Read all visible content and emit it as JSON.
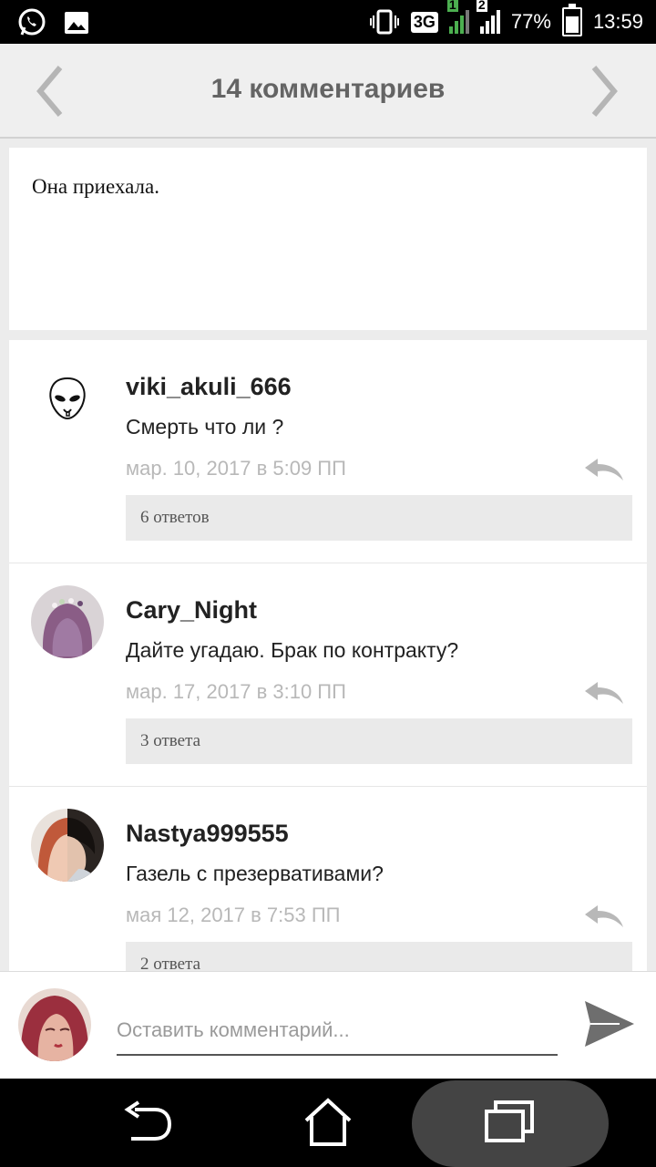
{
  "status_bar": {
    "network_type": "3G",
    "sim1_label": "1",
    "sim2_label": "2",
    "battery_percent": "77%",
    "battery_level": 0.77,
    "time": "13:59"
  },
  "header": {
    "title": "14 комментариев"
  },
  "post": {
    "text": "Она приехала."
  },
  "comments": [
    {
      "username": "viki_akuli_666",
      "text": "Смерть что ли ?",
      "date": "мар. 10, 2017 в 5:09 ПП",
      "replies_label": "6 ответов"
    },
    {
      "username": "Cary_Night",
      "text": "Дайте угадаю. Брак по контракту?",
      "date": "мар. 17, 2017 в 3:10 ПП",
      "replies_label": "3 ответа"
    },
    {
      "username": "Nastya999555",
      "text": "Газель с презервативами?",
      "date": "мая 12, 2017 в 7:53 ПП",
      "replies_label": "2 ответа"
    }
  ],
  "compose": {
    "placeholder": "Оставить комментарий..."
  },
  "colors": {
    "header_bg": "#efefef",
    "page_bg": "#ececec",
    "date_gray": "#b8b8b8",
    "replies_bg": "#eaeaea"
  },
  "icons": {
    "status_left": [
      "whatsapp-icon",
      "image-icon"
    ],
    "status_right": [
      "vibrate-icon",
      "signal-icon",
      "battery-icon"
    ],
    "nav": [
      "back-icon",
      "home-icon",
      "recents-icon"
    ]
  }
}
